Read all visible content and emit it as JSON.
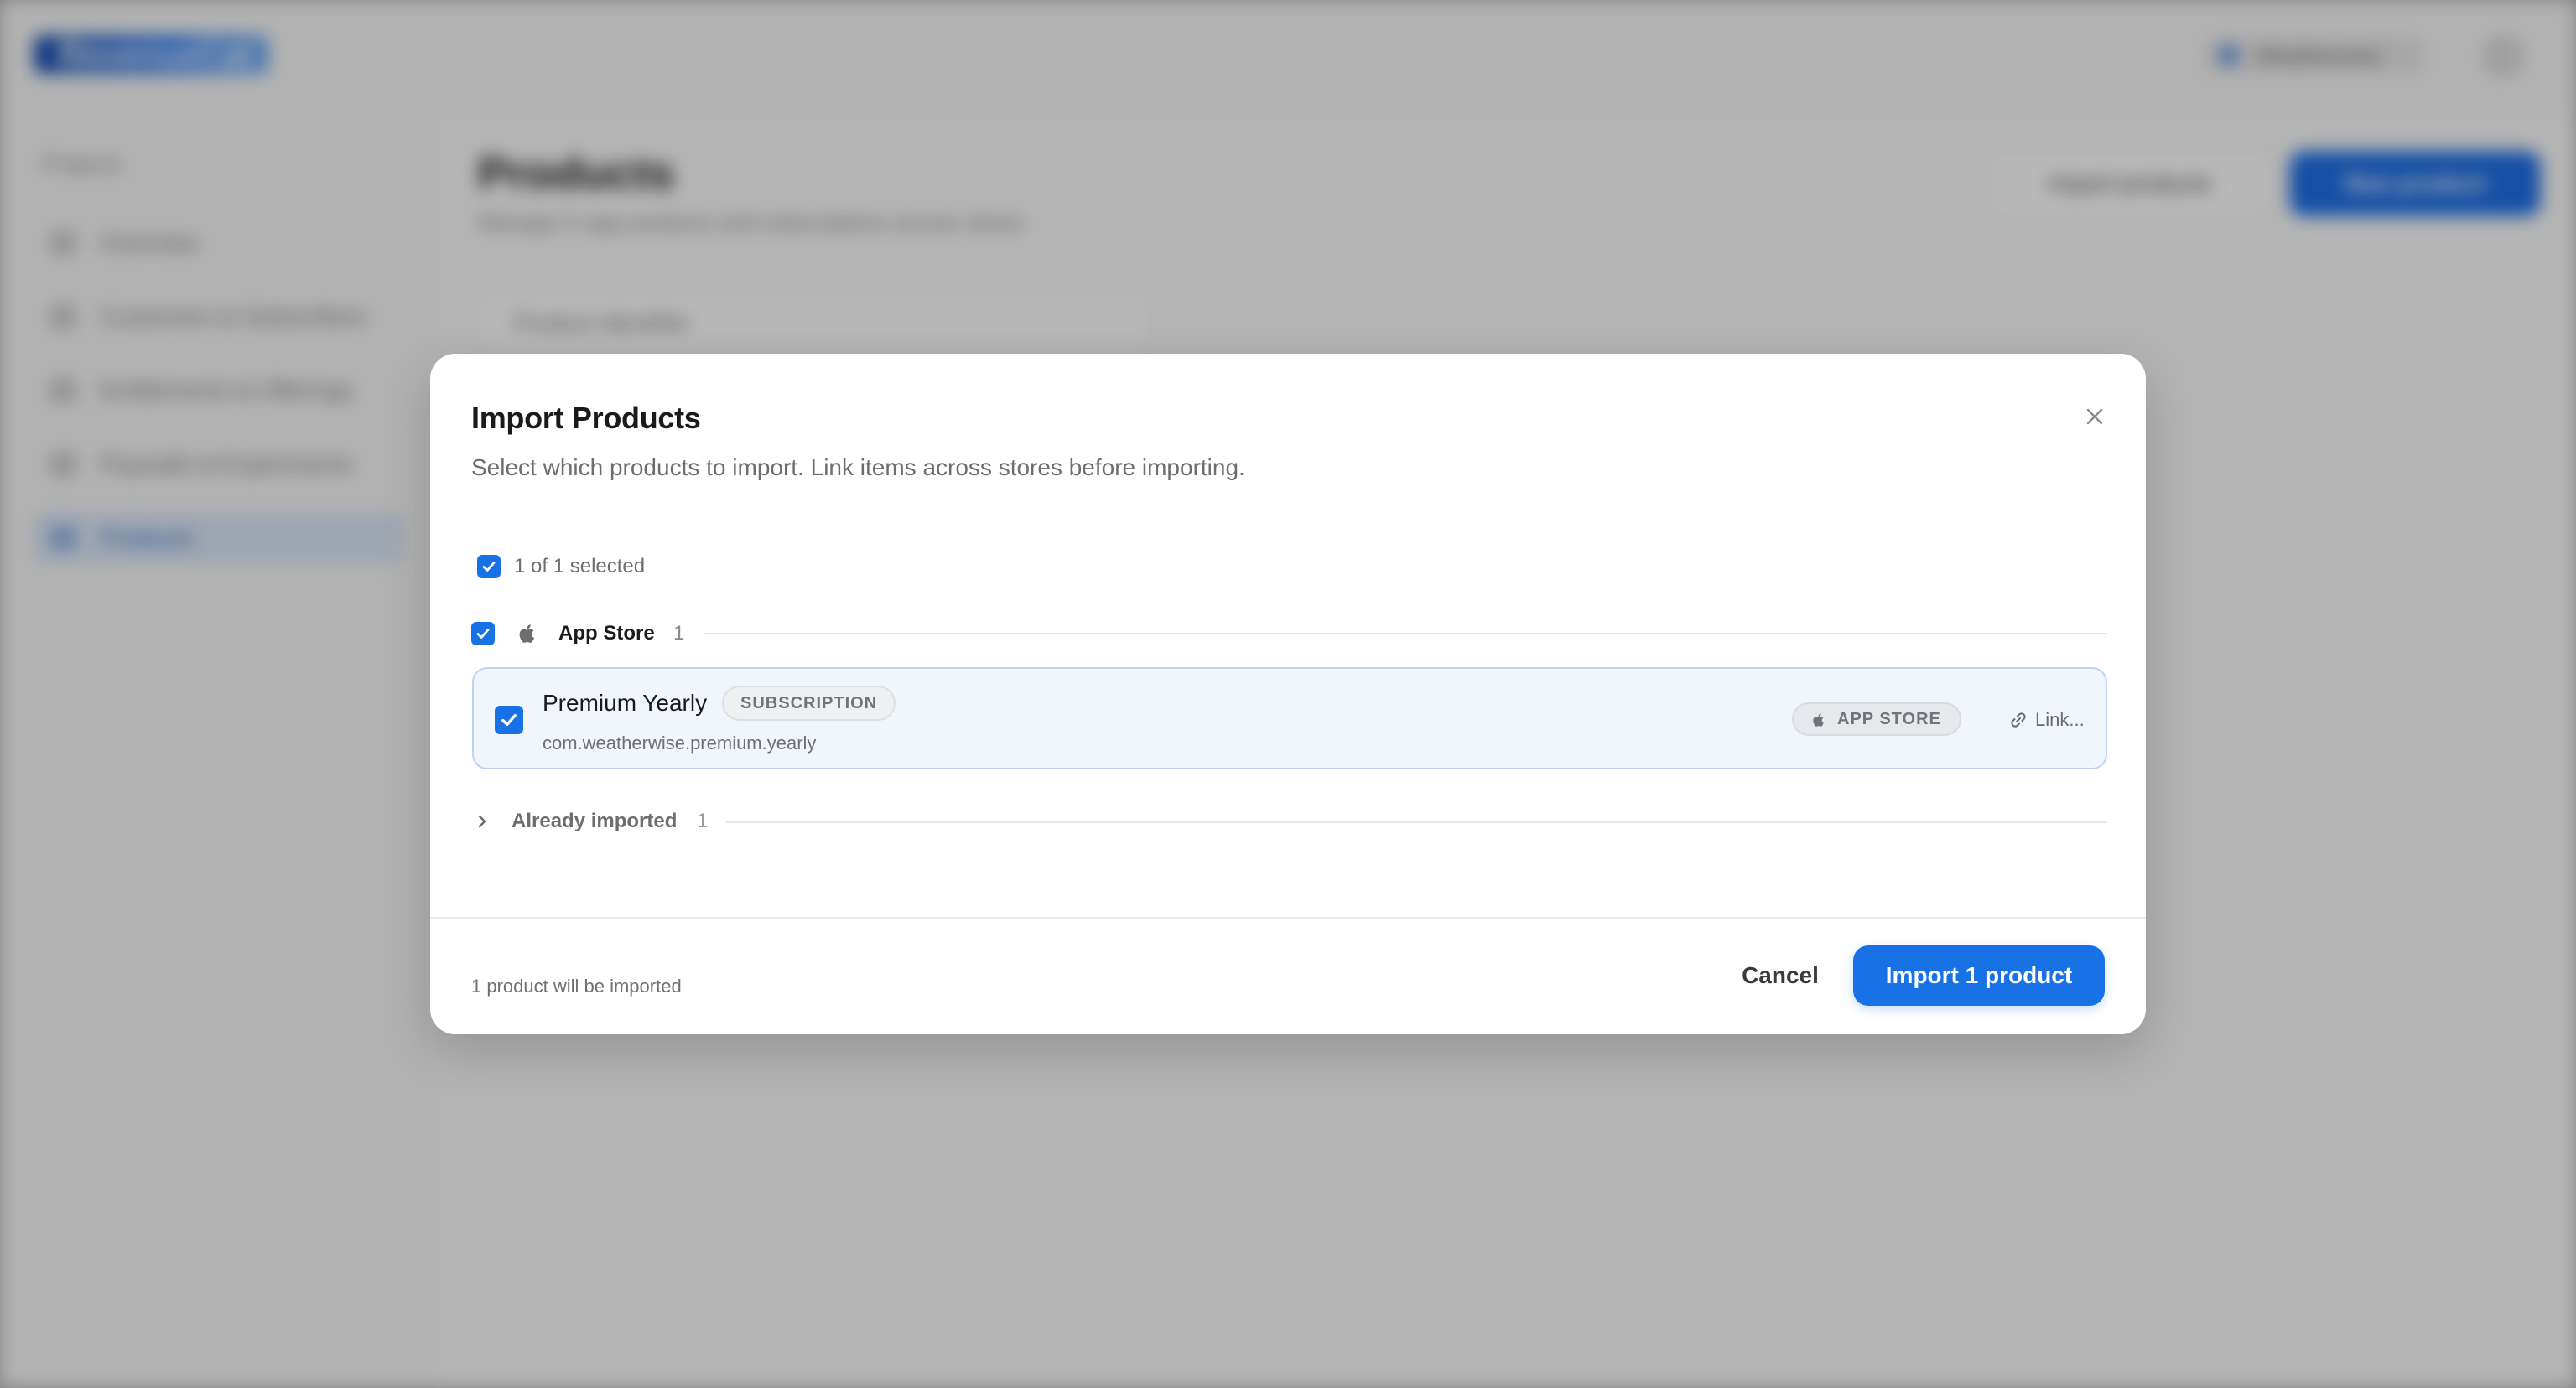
{
  "background": {
    "logo": "RevenueCat",
    "org": "Weatherwise",
    "sidebar_back": "Projects",
    "sidebar_items": [
      {
        "label": "Overview"
      },
      {
        "label": "Customers & Subscribers"
      },
      {
        "label": "Entitlements & Offerings"
      },
      {
        "label": "Paywalls & Experiments"
      },
      {
        "label": "Products"
      }
    ],
    "page_title": "Products",
    "page_subtitle": "Manage in-app products and subscriptions across stores",
    "btn_ghost": "Import products",
    "btn_primary": "New product",
    "search_placeholder": "Product Identifier"
  },
  "modal": {
    "title": "Import Products",
    "description": "Select which products to import. Link items across stores before importing.",
    "select_all_label": "1 of 1 selected",
    "group": {
      "name": "App Store",
      "count": "1",
      "products": [
        {
          "name": "Premium Yearly",
          "type_badge": "SUBSCRIPTION",
          "identifier": "com.weatherwise.premium.yearly",
          "store_badge": "APP STORE",
          "link_label": "Link..."
        }
      ]
    },
    "already_imported": {
      "label": "Already imported",
      "count": "1"
    },
    "footer": {
      "summary": "1 product will be imported",
      "cancel": "Cancel",
      "import": "Import 1 product"
    }
  },
  "colors": {
    "accent": "#1872e6",
    "card_bg": "#f1f6fd",
    "card_border": "#bcd3f5"
  },
  "icons": [
    "apple-icon",
    "close-icon",
    "checkmark-icon",
    "link-icon",
    "chevron-right-icon"
  ]
}
